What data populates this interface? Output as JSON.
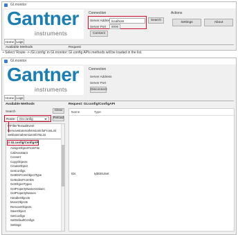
{
  "window1": {
    "title": "GI.monitor",
    "logo_main": "Gantner",
    "logo_sub": "instruments",
    "connection": {
      "group_title": "Connection",
      "server_address_label": "Server Address",
      "server_address_value": "localhost",
      "search_label": "Search",
      "server_port_label": "Server Port",
      "server_port_value": "8090",
      "connect_label": "Connect"
    },
    "actions": {
      "group_title": "Actions",
      "settings_label": "Settings",
      "about_label": "About"
    },
    "tabs": [
      "Home",
      "Logs"
    ],
    "available_methods_title": "Available Methods",
    "request_title": "Request"
  },
  "caption": "Select 'Route -> /GI.config' in GI.monitor: GI.config APIs methods will be loaded in the list.",
  "window2": {
    "title": "GI.monitor",
    "logo_main": "Gantner",
    "logo_sub": "instruments",
    "connection": {
      "group_title": "Connection",
      "server_address_label": "Server Address",
      "server_port_label": "Server Port",
      "disconnect_label": "Disconnect"
    },
    "tabs": [
      "Home",
      "Logs"
    ],
    "available_methods_title": "Available Methods",
    "search_label": "Search",
    "clear_label": "Clear",
    "route_label": "Route",
    "route_value": "/GI.config",
    "reload_label": "Reload",
    "top_items": [
      "PrFilterTextualEvent",
      "RemoveExternalVersionInfoFromList",
      "SetExternalVersionInfoToList"
    ],
    "group_header": "GI.config/ConfigAPI",
    "methods": [
      "AssignObjectFromFile",
      "CallAssistant",
      "Convert",
      "CopyObjects",
      "CreateObject",
      "GetConfigs",
      "GetIDsFromObjectType",
      "GetIndexFromIDs",
      "GetObjectTypes",
      "GetPropertyNamesValues",
      "GetPropertyNames",
      "HandleObjects",
      "MoveObjects",
      "RemoveObjects",
      "SaveObject",
      "SetConfigs",
      "SetDefaultConfigs",
      "Settings"
    ],
    "request_title": "Request: GI.config/ConfigAPI",
    "col_name": "Name",
    "col_type": "Type",
    "param_name": "IDs",
    "param_type": "ty$GEUSet"
  }
}
